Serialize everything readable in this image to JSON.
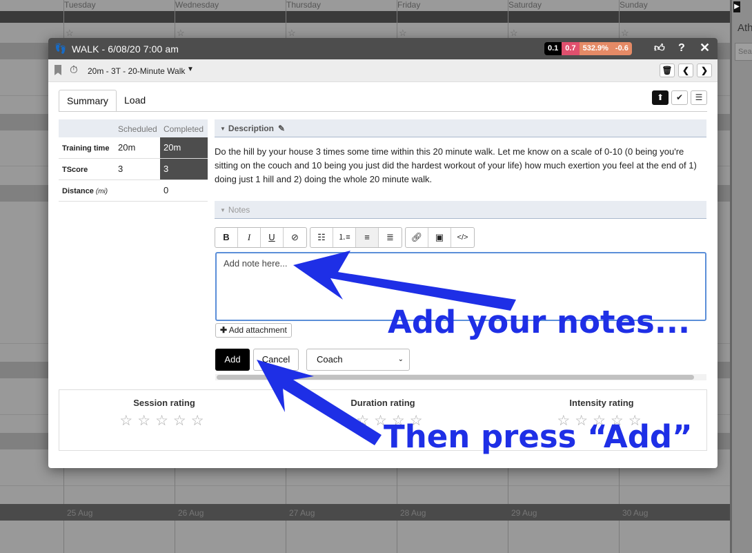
{
  "calendar": {
    "days": [
      "Tuesday",
      "Wednesday",
      "Thursday",
      "Friday",
      "Saturday",
      "Sunday"
    ],
    "dates": [
      "25 Aug",
      "26 Aug",
      "27 Aug",
      "28 Aug",
      "29 Aug",
      "30 Aug"
    ],
    "star": "☆",
    "right_panel_label": "Ath",
    "right_panel_search": "Sea"
  },
  "modal": {
    "icon": "footsteps-icon",
    "title": "WALK - 6/08/20 7:00 am",
    "metrics": [
      "0.1",
      "0.7",
      "532.9%",
      "-0.6"
    ],
    "metric_colors": [
      "#000000",
      "#e0506e",
      "#e58a66",
      "#e58a66"
    ],
    "workout_label": "20m - 3T - 20-Minute Walk",
    "tabs": [
      "Summary",
      "Load"
    ],
    "active_tab": "Summary",
    "stats": {
      "headers": [
        "Scheduled",
        "Completed"
      ],
      "rows": [
        {
          "label": "Training time",
          "unit": "",
          "scheduled": "20m",
          "completed": "20m"
        },
        {
          "label": "TScore",
          "unit": "",
          "scheduled": "3",
          "completed": "3"
        },
        {
          "label": "Distance",
          "unit": "(mi)",
          "scheduled": "",
          "completed": "0"
        }
      ]
    },
    "description_header": "Description",
    "description": "Do the hill by your house 3 times some time within this 20 minute walk. Let me know on a scale of 0-10 (0 being you're sitting on the couch and 10 being you just did the hardest workout of your life) how much exertion you feel at the end of 1) doing just 1 hill and 2) doing the whole 20 minute walk.",
    "notes_header": "Notes",
    "note_placeholder": "Add note here...",
    "add_attachment": "Add attachment",
    "add_button": "Add",
    "cancel_button": "Cancel",
    "role_select": "Coach",
    "ratings": [
      {
        "title": "Session rating",
        "stars": "☆☆☆☆☆"
      },
      {
        "title": "Duration rating",
        "stars": "☆☆☆☆☆"
      },
      {
        "title": "Intensity rating",
        "stars": "☆☆☆☆☆"
      }
    ]
  },
  "annotations": {
    "line1": "Add your notes...",
    "line2": "Then press “Add”",
    "color": "#1e2fe6"
  }
}
